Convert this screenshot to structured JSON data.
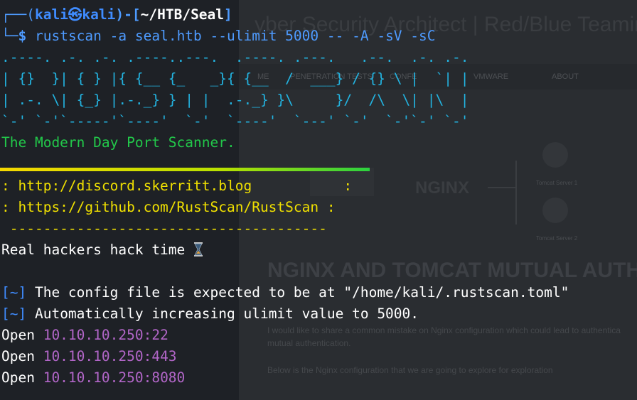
{
  "background_site": {
    "title": "yber Security Architect | Red/Blue Teamin",
    "nav": [
      "ME",
      "PENETRATION TESTS",
      "CONFE",
      "VMWARE",
      "ABOUT"
    ],
    "nginx_label": "NGINX",
    "tomcat1": "Tomcat Server 1",
    "tomcat2": "Tomcat Server 2",
    "heading": "NGINX AND TOMCAT MUTUAL AUTH BYPASS",
    "para1": "I would like to share a common mistake on Nginx configuration which could lead to authentica",
    "para2": "mutual authentication.",
    "para3": "Below is the Nginx configuration that we are going to explore for exploration"
  },
  "prompt": {
    "box_top": "┌──(",
    "user": "kali㉿kali",
    "mid": ")-[",
    "path": "~/HTB/Seal",
    "end": "]",
    "box_bottom": "└─",
    "dollar": "$",
    "command": "rustscan",
    "args": " -a seal.htb --ulimit 5000 -- -A -sV -sC"
  },
  "ascii_art": [
    ".----. .-. .-. .----..---.  .----. .---.   .--.  .-. .-.",
    "| {}  }| { } |{ {__ {_   _}{ {__  /  ___} / {} \\ |  `| |",
    "| .-. \\| {_} |.-._} } | |  .-._} }\\     }/  /\\  \\| |\\  |",
    "`-' `-'`-----'`----'  `-'  `----'  `---' `-'  `-'`-' `-'"
  ],
  "tagline": "The Modern Day Port Scanner.",
  "links": {
    "discord": ": http://discord.skerritt.blog           :",
    "github": ": https://github.com/RustScan/RustScan :",
    "dashes": " --------------------------------------"
  },
  "quote": "Real hackers hack time",
  "hourglass_icon": "hourglass",
  "info_prefix": "[~]",
  "info1": " The config file is expected to be at \"/home/kali/.rustscan.toml\"",
  "info2": " Automatically increasing ulimit value to 5000.",
  "open_label": "Open ",
  "ports": [
    "10.10.10.250:22",
    "10.10.10.250:443",
    "10.10.10.250:8080"
  ]
}
